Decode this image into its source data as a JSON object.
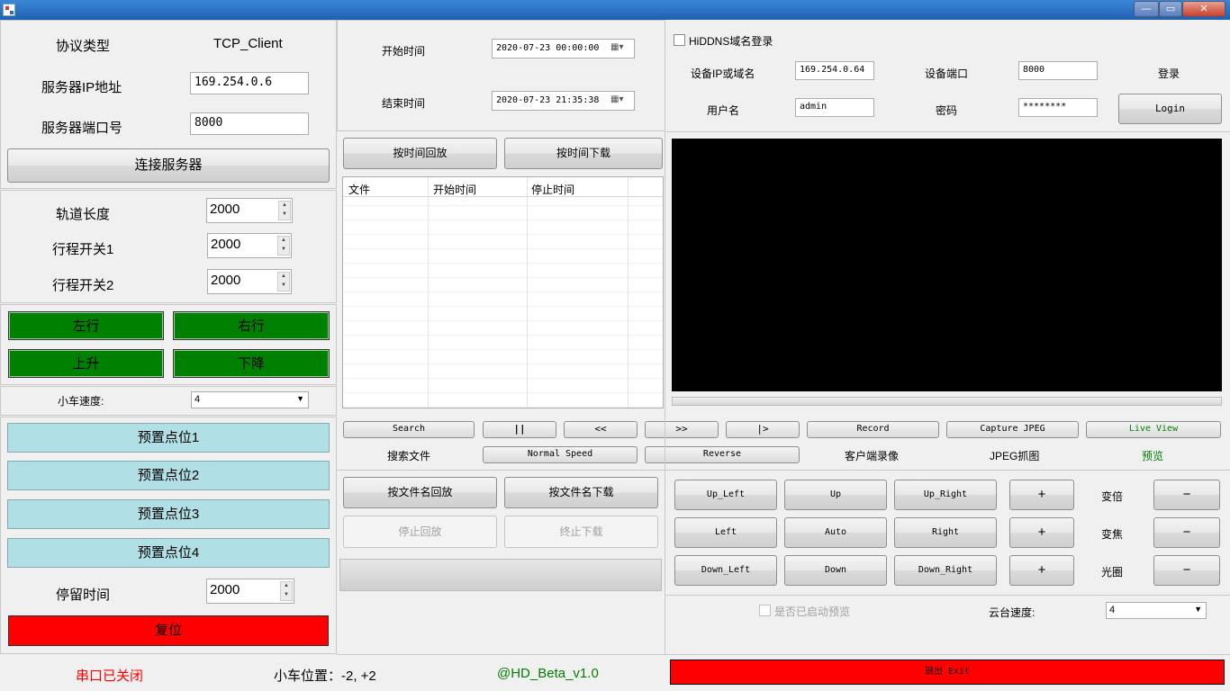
{
  "window": {
    "minimize": "—",
    "maximize": "▭",
    "close": "✕"
  },
  "left": {
    "protocol_label": "协议类型",
    "protocol_value": "TCP_Client",
    "ip_label": "服务器IP地址",
    "ip_value": "169.254.0.6",
    "port_label": "服务器端口号",
    "port_value": "8000",
    "connect": "连接服务器",
    "track_label": "轨道长度",
    "track_value": "2000",
    "sw1_label": "行程开关1",
    "sw1_value": "2000",
    "sw2_label": "行程开关2",
    "sw2_value": "2000",
    "left": "左行",
    "right": "右行",
    "up": "上升",
    "down": "下降",
    "speed_label": "小车速度:",
    "speed_value": "4",
    "preset1": "预置点位1",
    "preset2": "预置点位2",
    "preset3": "预置点位3",
    "preset4": "预置点位4",
    "dwell_label": "停留时间",
    "dwell_value": "2000",
    "reset": "复位",
    "serial_status": "串口已关闭",
    "position": "小车位置：-2, +2"
  },
  "mid": {
    "start_label": "开始时间",
    "start_value": "2020-07-23 00:00:00",
    "end_label": "结束时间",
    "end_value": "2020-07-23 21:35:38",
    "play_by_time": "按时间回放",
    "download_by_time": "按时间下载",
    "columns": [
      "文件",
      "开始时间",
      "停止时间"
    ],
    "search": "Search",
    "pause": "||",
    "slow": "<<",
    "fast": ">>",
    "step": "|>",
    "search_file": "搜索文件",
    "normal_speed": "Normal Speed",
    "reverse": "Reverse",
    "play_by_name": "按文件名回放",
    "download_by_name": "按文件名下载",
    "stop_play": "停止回放",
    "stop_download": "终止下载",
    "version": "@HD_Beta_v1.0"
  },
  "right": {
    "ddns": "HiDDNS域名登录",
    "ip_label": "设备IP或域名",
    "ip_value": "169.254.0.64",
    "port_label": "设备端口",
    "port_value": "8000",
    "login_label": "登录",
    "user_label": "用户名",
    "user_value": "admin",
    "pwd_label": "密码",
    "pwd_value": "********",
    "login": "Login",
    "record": "Record",
    "capture": "Capture JPEG",
    "live": "Live View",
    "record_cap": "客户端录像",
    "capture_cap": "JPEG抓图",
    "live_cap": "预览",
    "ptz": [
      "Up_Left",
      "Up",
      "Up_Right",
      "Left",
      "Auto",
      "Right",
      "Down_Left",
      "Down",
      "Down_Right"
    ],
    "plus": "+",
    "minus": "−",
    "zoom": "变倍",
    "focus": "变焦",
    "iris": "光圈",
    "preview_started": "是否已启动预览",
    "ptz_speed_label": "云台速度:",
    "ptz_speed_value": "4",
    "exit": "退出 Exit",
    "colors": {
      "green_text": "#008000",
      "red": "#ff0000",
      "video": "#000000"
    }
  }
}
